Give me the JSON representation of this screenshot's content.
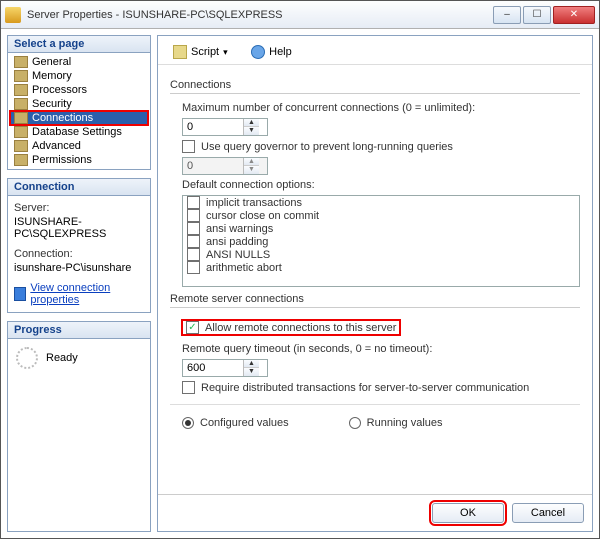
{
  "title": "Server Properties - ISUNSHARE-PC\\SQLEXPRESS",
  "winbtns": {
    "min": "–",
    "max": "☐",
    "close": "✕"
  },
  "sidebar": {
    "header": "Select a page",
    "items": [
      {
        "label": "General"
      },
      {
        "label": "Memory"
      },
      {
        "label": "Processors"
      },
      {
        "label": "Security"
      },
      {
        "label": "Connections",
        "selected": true
      },
      {
        "label": "Database Settings"
      },
      {
        "label": "Advanced"
      },
      {
        "label": "Permissions"
      }
    ]
  },
  "connection_panel": {
    "header": "Connection",
    "server_label": "Server:",
    "server_value": "ISUNSHARE-PC\\SQLEXPRESS",
    "connection_label": "Connection:",
    "connection_value": "isunshare-PC\\isunshare",
    "link": "View connection properties"
  },
  "progress_panel": {
    "header": "Progress",
    "status": "Ready"
  },
  "toolbar": {
    "script": "Script",
    "help": "Help"
  },
  "main": {
    "group_connections": "Connections",
    "max_conn_label": "Maximum number of concurrent connections (0 = unlimited):",
    "max_conn_value": "0",
    "query_gov_label": "Use query governor to prevent long-running queries",
    "query_gov_checked": false,
    "query_gov_value": "0",
    "default_opts_label": "Default connection options:",
    "default_opts": [
      "implicit transactions",
      "cursor close on commit",
      "ansi warnings",
      "ansi padding",
      "ANSI NULLS",
      "arithmetic abort"
    ],
    "group_remote": "Remote server connections",
    "allow_remote_label": "Allow remote connections to this server",
    "allow_remote_checked": true,
    "remote_timeout_label": "Remote query timeout (in seconds, 0 = no timeout):",
    "remote_timeout_value": "600",
    "require_dist_label": "Require distributed transactions for server-to-server communication",
    "require_dist_checked": false,
    "radio_configured": "Configured values",
    "radio_running": "Running values",
    "radio_selected": "configured"
  },
  "footer": {
    "ok": "OK",
    "cancel": "Cancel"
  }
}
